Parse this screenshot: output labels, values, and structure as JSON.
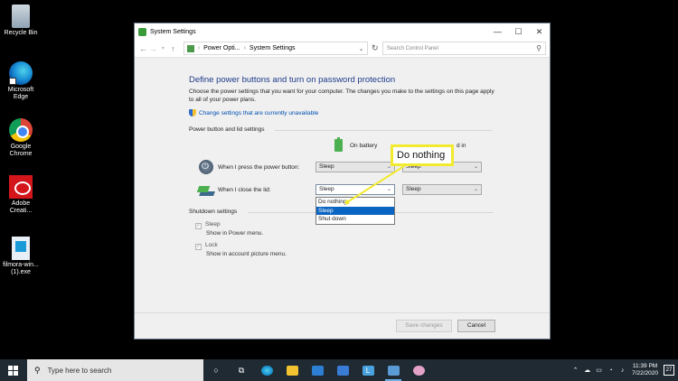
{
  "desktop": {
    "icons": [
      {
        "label": "Recycle Bin",
        "icon": "recycle-bin-icon"
      },
      {
        "label": "Microsoft Edge",
        "icon": "edge-icon"
      },
      {
        "label": "Google Chrome",
        "icon": "chrome-icon"
      },
      {
        "label": "Adobe Creati...",
        "icon": "adobe-creative-cloud-icon"
      },
      {
        "label": "filmora-win... (1).exe",
        "icon": "filmora-installer-icon"
      }
    ]
  },
  "window": {
    "title": "System Settings",
    "controls": {
      "minimize": "—",
      "maximize": "☐",
      "close": "✕"
    },
    "address": {
      "crumbs": [
        "Power Opti...",
        "System Settings"
      ],
      "search_placeholder": "Search Control Panel"
    },
    "content": {
      "heading": "Define power buttons and turn on password protection",
      "description": "Choose the power settings that you want for your computer. The changes you make to the settings on this page apply to all of your power plans.",
      "change_link": "Change settings that are currently unavailable",
      "power_section_label": "Power button and lid settings",
      "col_on_battery": "On battery",
      "col_plugged_in": "d in",
      "rows": [
        {
          "label": "When I press the power button:",
          "battery": "Sleep",
          "plugged": "Sleep"
        },
        {
          "label": "When I close the lid:",
          "battery": "Sleep",
          "plugged": "Sleep"
        }
      ],
      "dropdown_options": [
        "Do nothing",
        "Sleep",
        "Shut down"
      ],
      "dropdown_selected_index": 1,
      "shutdown_section_label": "Shutdown settings",
      "checkboxes": [
        {
          "label": "Sleep",
          "sub": "Show in Power menu."
        },
        {
          "label": "Lock",
          "sub": "Show in account picture menu."
        }
      ],
      "save_button": "Save changes",
      "cancel_button": "Cancel"
    }
  },
  "callout": {
    "text": "Do nothing",
    "color": "#f2ea2e"
  },
  "taskbar": {
    "search_placeholder": "Type here to search",
    "time": "11:39 PM",
    "date": "7/22/2020",
    "notification_count": "27"
  }
}
